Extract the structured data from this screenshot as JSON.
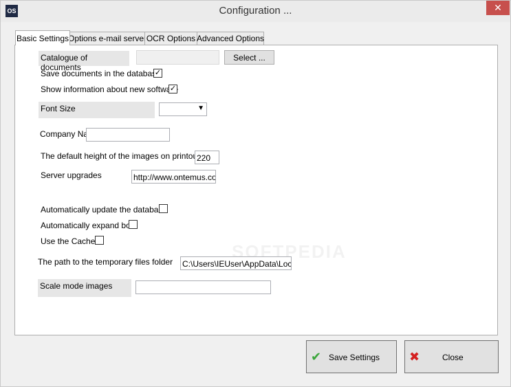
{
  "window": {
    "title": "Configuration ...",
    "app_icon": "OS",
    "close_glyph": "✕"
  },
  "tabs": [
    {
      "label": "Basic Settings",
      "active": true
    },
    {
      "label": "Options e-mail server",
      "active": false
    },
    {
      "label": "OCR Options",
      "active": false
    },
    {
      "label": "Advanced Options",
      "active": false
    }
  ],
  "basic": {
    "catalogue_label": "Catalogue of documents",
    "catalogue_value": "",
    "select_button": "Select ...",
    "save_docs_label": "Save documents in the database",
    "save_docs_checked": true,
    "show_info_label": "Show information about new software",
    "show_info_checked": true,
    "font_size_label": "Font Size",
    "font_size_value": "",
    "company_label": "Company Name",
    "company_value": "",
    "img_height_label": "The default height of the images on printouts",
    "img_height_value": "220",
    "server_label": "Server upgrades",
    "server_value": "http://www.ontemus.com",
    "auto_update_label": "Automatically update the database",
    "auto_update_checked": false,
    "auto_expand_label": "Automatically expand box",
    "auto_expand_checked": false,
    "cache_label": "Use the Cache",
    "cache_checked": false,
    "temp_path_label": "The path to the temporary files folder",
    "temp_path_value": "C:\\Users\\IEUser\\AppData\\Local",
    "scale_label": "Scale mode images",
    "scale_value": ""
  },
  "footer": {
    "save_label": "Save Settings",
    "close_label": "Close"
  },
  "watermark": "SOFTPEDIA",
  "colors": {
    "close_button": "#c7504d",
    "check_icon": "#3aa53a",
    "cross_icon": "#d42020"
  }
}
